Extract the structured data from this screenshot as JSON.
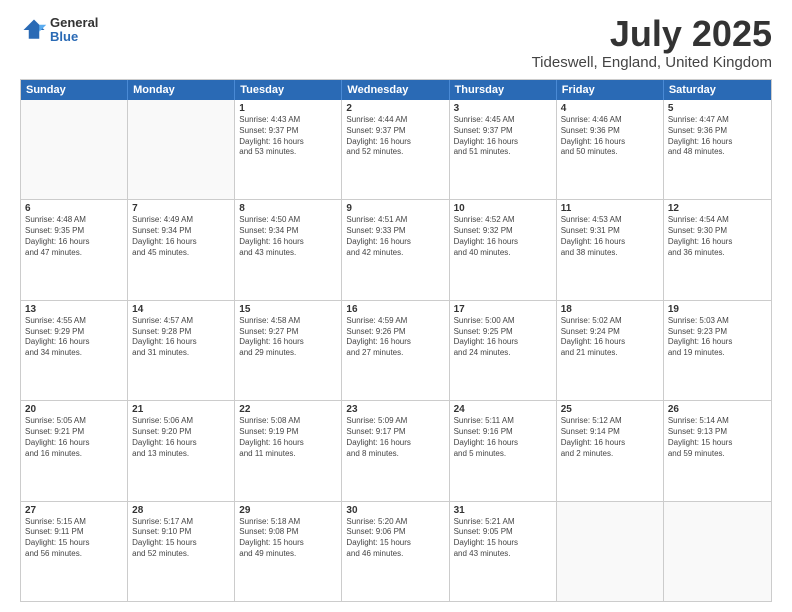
{
  "logo": {
    "general": "General",
    "blue": "Blue"
  },
  "title": "July 2025",
  "subtitle": "Tideswell, England, United Kingdom",
  "days": [
    "Sunday",
    "Monday",
    "Tuesday",
    "Wednesday",
    "Thursday",
    "Friday",
    "Saturday"
  ],
  "weeks": [
    [
      {
        "day": "",
        "info": ""
      },
      {
        "day": "",
        "info": ""
      },
      {
        "day": "1",
        "info": "Sunrise: 4:43 AM\nSunset: 9:37 PM\nDaylight: 16 hours\nand 53 minutes."
      },
      {
        "day": "2",
        "info": "Sunrise: 4:44 AM\nSunset: 9:37 PM\nDaylight: 16 hours\nand 52 minutes."
      },
      {
        "day": "3",
        "info": "Sunrise: 4:45 AM\nSunset: 9:37 PM\nDaylight: 16 hours\nand 51 minutes."
      },
      {
        "day": "4",
        "info": "Sunrise: 4:46 AM\nSunset: 9:36 PM\nDaylight: 16 hours\nand 50 minutes."
      },
      {
        "day": "5",
        "info": "Sunrise: 4:47 AM\nSunset: 9:36 PM\nDaylight: 16 hours\nand 48 minutes."
      }
    ],
    [
      {
        "day": "6",
        "info": "Sunrise: 4:48 AM\nSunset: 9:35 PM\nDaylight: 16 hours\nand 47 minutes."
      },
      {
        "day": "7",
        "info": "Sunrise: 4:49 AM\nSunset: 9:34 PM\nDaylight: 16 hours\nand 45 minutes."
      },
      {
        "day": "8",
        "info": "Sunrise: 4:50 AM\nSunset: 9:34 PM\nDaylight: 16 hours\nand 43 minutes."
      },
      {
        "day": "9",
        "info": "Sunrise: 4:51 AM\nSunset: 9:33 PM\nDaylight: 16 hours\nand 42 minutes."
      },
      {
        "day": "10",
        "info": "Sunrise: 4:52 AM\nSunset: 9:32 PM\nDaylight: 16 hours\nand 40 minutes."
      },
      {
        "day": "11",
        "info": "Sunrise: 4:53 AM\nSunset: 9:31 PM\nDaylight: 16 hours\nand 38 minutes."
      },
      {
        "day": "12",
        "info": "Sunrise: 4:54 AM\nSunset: 9:30 PM\nDaylight: 16 hours\nand 36 minutes."
      }
    ],
    [
      {
        "day": "13",
        "info": "Sunrise: 4:55 AM\nSunset: 9:29 PM\nDaylight: 16 hours\nand 34 minutes."
      },
      {
        "day": "14",
        "info": "Sunrise: 4:57 AM\nSunset: 9:28 PM\nDaylight: 16 hours\nand 31 minutes."
      },
      {
        "day": "15",
        "info": "Sunrise: 4:58 AM\nSunset: 9:27 PM\nDaylight: 16 hours\nand 29 minutes."
      },
      {
        "day": "16",
        "info": "Sunrise: 4:59 AM\nSunset: 9:26 PM\nDaylight: 16 hours\nand 27 minutes."
      },
      {
        "day": "17",
        "info": "Sunrise: 5:00 AM\nSunset: 9:25 PM\nDaylight: 16 hours\nand 24 minutes."
      },
      {
        "day": "18",
        "info": "Sunrise: 5:02 AM\nSunset: 9:24 PM\nDaylight: 16 hours\nand 21 minutes."
      },
      {
        "day": "19",
        "info": "Sunrise: 5:03 AM\nSunset: 9:23 PM\nDaylight: 16 hours\nand 19 minutes."
      }
    ],
    [
      {
        "day": "20",
        "info": "Sunrise: 5:05 AM\nSunset: 9:21 PM\nDaylight: 16 hours\nand 16 minutes."
      },
      {
        "day": "21",
        "info": "Sunrise: 5:06 AM\nSunset: 9:20 PM\nDaylight: 16 hours\nand 13 minutes."
      },
      {
        "day": "22",
        "info": "Sunrise: 5:08 AM\nSunset: 9:19 PM\nDaylight: 16 hours\nand 11 minutes."
      },
      {
        "day": "23",
        "info": "Sunrise: 5:09 AM\nSunset: 9:17 PM\nDaylight: 16 hours\nand 8 minutes."
      },
      {
        "day": "24",
        "info": "Sunrise: 5:11 AM\nSunset: 9:16 PM\nDaylight: 16 hours\nand 5 minutes."
      },
      {
        "day": "25",
        "info": "Sunrise: 5:12 AM\nSunset: 9:14 PM\nDaylight: 16 hours\nand 2 minutes."
      },
      {
        "day": "26",
        "info": "Sunrise: 5:14 AM\nSunset: 9:13 PM\nDaylight: 15 hours\nand 59 minutes."
      }
    ],
    [
      {
        "day": "27",
        "info": "Sunrise: 5:15 AM\nSunset: 9:11 PM\nDaylight: 15 hours\nand 56 minutes."
      },
      {
        "day": "28",
        "info": "Sunrise: 5:17 AM\nSunset: 9:10 PM\nDaylight: 15 hours\nand 52 minutes."
      },
      {
        "day": "29",
        "info": "Sunrise: 5:18 AM\nSunset: 9:08 PM\nDaylight: 15 hours\nand 49 minutes."
      },
      {
        "day": "30",
        "info": "Sunrise: 5:20 AM\nSunset: 9:06 PM\nDaylight: 15 hours\nand 46 minutes."
      },
      {
        "day": "31",
        "info": "Sunrise: 5:21 AM\nSunset: 9:05 PM\nDaylight: 15 hours\nand 43 minutes."
      },
      {
        "day": "",
        "info": ""
      },
      {
        "day": "",
        "info": ""
      }
    ]
  ]
}
